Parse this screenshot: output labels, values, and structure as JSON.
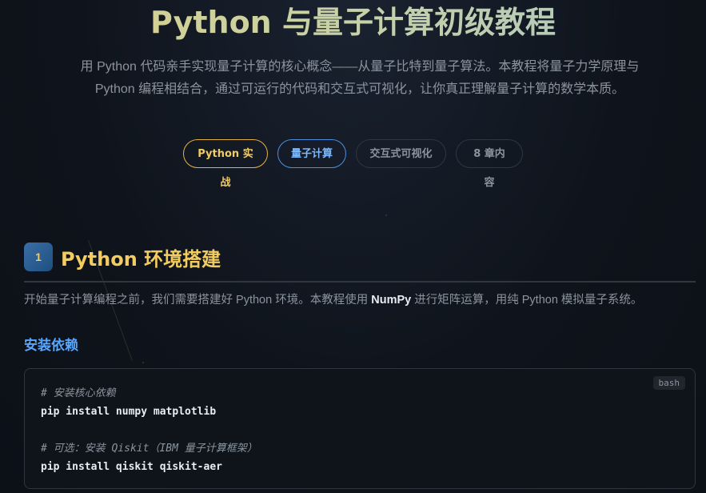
{
  "hero": {
    "title": "Python 与量子计算初级教程",
    "description": "用 Python 代码亲手实现量子计算的核心概念——从量子比特到量子算法。本教程将量子力学原理与 Python 编程相结合，通过可运行的代码和交互式可视化，让你真正理解量子计算的数学本质。",
    "tags": [
      "Python 实战",
      "量子计算",
      "交互式可视化",
      "8 章内容"
    ]
  },
  "section1": {
    "number": "1",
    "title": "Python 环境搭建",
    "para_before": "开始量子计算编程之前，我们需要搭建好 Python 环境。本教程使用 ",
    "para_bold": "NumPy",
    "para_after": " 进行矩阵运算，用纯 Python 模拟量子系统。",
    "subtitle": "安装依赖",
    "code_lang": "bash",
    "code": {
      "comment1": "# 安装核心依赖",
      "cmd1": "pip install numpy matplotlib",
      "comment2": "# 可选：安装 Qiskit（IBM 量子计算框架）",
      "cmd2": "pip install qiskit qiskit-aer"
    }
  },
  "colors": {
    "accent_yellow": "#f2cc60",
    "accent_blue": "#58a6ff",
    "background": "#0f141c"
  }
}
